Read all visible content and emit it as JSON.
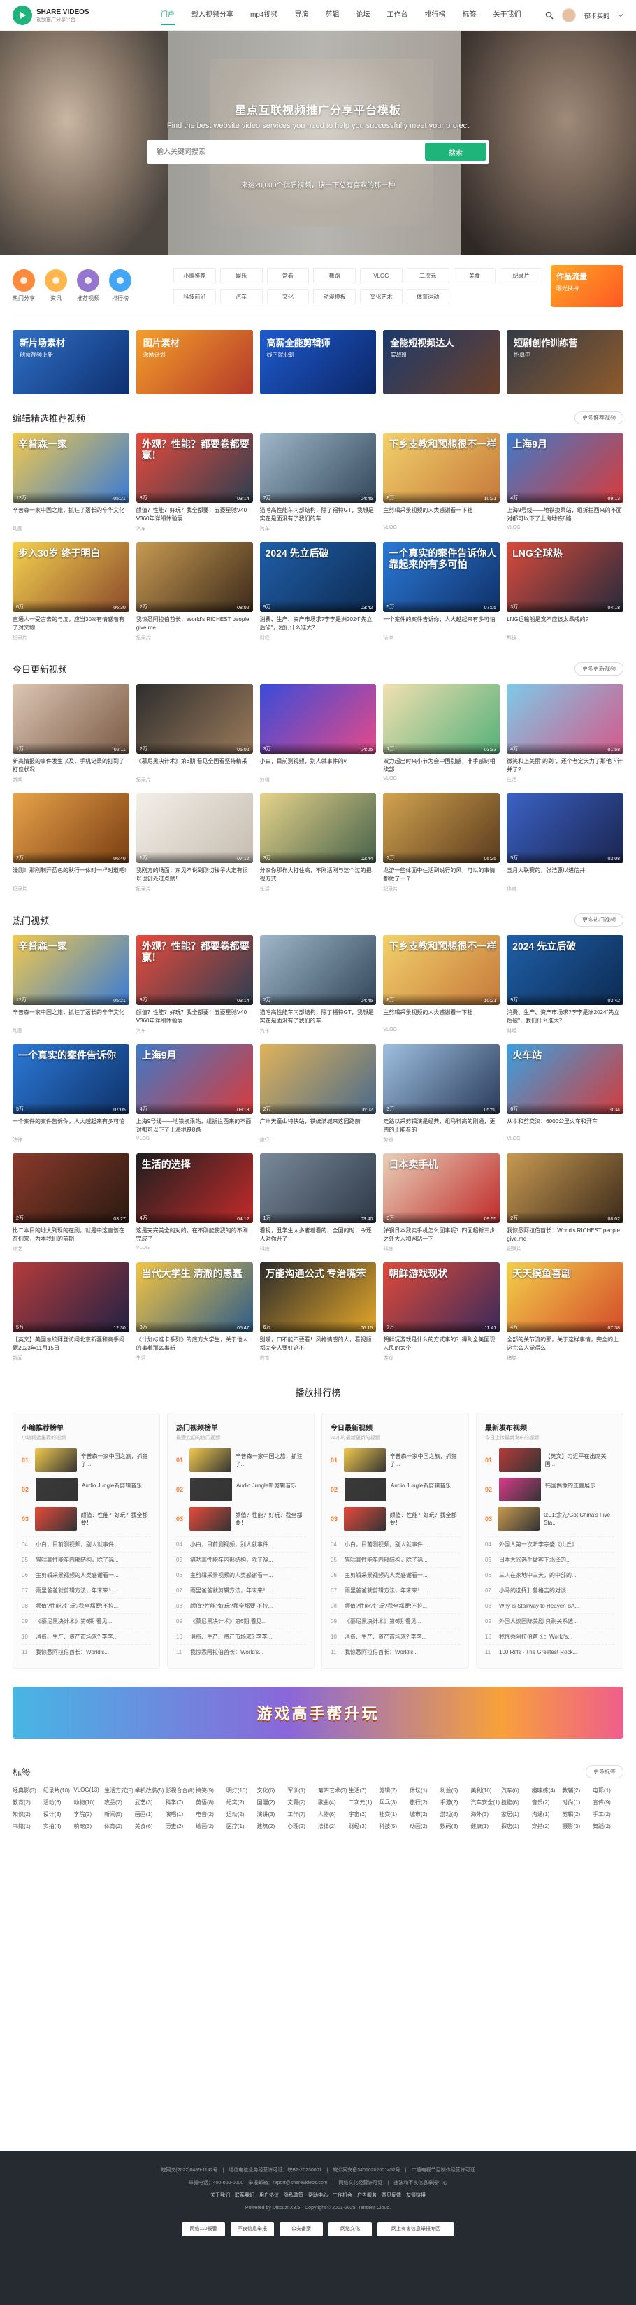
{
  "header": {
    "logo_title": "SHARE VIDEOS",
    "logo_sub": "视频推广分享平台",
    "nav": [
      "门户",
      "载入视频分享",
      "mp4视频",
      "导演",
      "剪辑",
      "论坛",
      "工作台",
      "排行榜",
      "标签",
      "关于我们"
    ],
    "user": "郁卡买的"
  },
  "hero": {
    "title": "星点互联视频推广分享平台模板",
    "subtitle": "Find the best website video services you need to help you successfully meet your project",
    "search_placeholder": "输入关键词搜索",
    "search_button": "搜索",
    "stat": "来这20,000个优质视频，搜一下总有喜欢的那一种"
  },
  "quick": [
    {
      "label": "热门分享",
      "color": "#ff8a3d"
    },
    {
      "label": "资讯",
      "color": "#ffb74d"
    },
    {
      "label": "推荐视频",
      "color": "#9575cd"
    },
    {
      "label": "排行榜",
      "color": "#42a5f5"
    }
  ],
  "tags": [
    "小编推荐",
    "娱乐",
    "常看",
    "舞蹈",
    "VLOG",
    "二次元",
    "美食",
    "纪录片",
    "科技前沿",
    "汽车",
    "文化",
    "动漫模板",
    "文化艺术",
    "体育运动"
  ],
  "promo": {
    "title": "作品流量",
    "sub": "曝光扶持"
  },
  "banners": [
    {
      "t": "新片场素材",
      "s": "创意视频上新",
      "c1": "#2f71c8",
      "c2": "#0e2f6e"
    },
    {
      "t": "图片素材",
      "s": "激励计划",
      "c1": "#f4a02a",
      "c2": "#b4392a"
    },
    {
      "t": "高薪全能剪辑师",
      "s": "线下就业班",
      "c1": "#1d5bcf",
      "c2": "#0c2666"
    },
    {
      "t": "全能短视频达人",
      "s": "实战班",
      "c1": "#1c3a6b",
      "c2": "#6b3f2a"
    },
    {
      "t": "短剧创作训练营",
      "s": "招募中",
      "c1": "#333a47",
      "c2": "#8f5b2a"
    }
  ],
  "sections": {
    "s1": {
      "title": "编辑精选推荐视频",
      "more": "更多推荐视频",
      "items": [
        {
          "tx": "辛普森一家",
          "meta": "12万",
          "dur": "05:21",
          "title": "辛普森一家中国之旅，抓狂了落长的辛华文化",
          "au": "动画",
          "c1": "#f2c94c",
          "c2": "#3a7bd5"
        },
        {
          "tx": "外观？性能？都要卷都要赢！",
          "meta": "3万",
          "dur": "03:14",
          "title": "颜值？性能？好玩？我全都要！五菱星驰V40 V360年详细体验展",
          "au": "汽车",
          "c1": "#e84a3c",
          "c2": "#2d3e50"
        },
        {
          "tx": "",
          "meta": "2万",
          "dur": "04:45",
          "title": "猫咕高性能车内部结构，除了福特GT，我想是实在是面没有了我们的车",
          "au": "汽车",
          "c1": "#9fb7c9",
          "c2": "#33475b"
        },
        {
          "tx": "下乡支教和预想很不一样",
          "meta": "8万",
          "dur": "10:21",
          "title": "主剪辑采景视频的人类感谢看一下社",
          "au": "VLOG",
          "c1": "#f2d16b",
          "c2": "#c6793a"
        },
        {
          "tx": "上海9月",
          "meta": "4万",
          "dur": "09:13",
          "title": "上海9号线——地铁换乘站，组拆拦西来的不面对都可以下了上海地铁8路",
          "au": "VLOG",
          "c1": "#3e7ac9",
          "c2": "#d83b3b"
        },
        {
          "tx": "步入30岁 终于明白",
          "meta": "6万",
          "dur": "06:30",
          "title": "直通人一受言去的与度，应当30%有情感着有了对文物",
          "au": "纪录片",
          "c1": "#f5d24e",
          "c2": "#8b4a2c"
        },
        {
          "tx": "",
          "meta": "2万",
          "dur": "08:02",
          "title": "我惊悉阿拉伯酋长：World's RICHEST people give.me",
          "au": "纪录片",
          "c1": "#c89a52",
          "c2": "#3b2a1a"
        },
        {
          "tx": "2024 先立后破",
          "meta": "9万",
          "dur": "03:42",
          "title": "消费、生产、资产市场求?李李是洲2024\"先立后破\"，我们什么准大？",
          "au": "财经",
          "c1": "#1f5fa8",
          "c2": "#0d2b52"
        },
        {
          "tx": "一个真实的案件告诉你人靠起来的有多可怕",
          "meta": "5万",
          "dur": "07:05",
          "title": "一个案件的案件告诉你，人大越起来有多可怕",
          "au": "法律",
          "c1": "#2b7ad8",
          "c2": "#0f3168"
        },
        {
          "tx": "LNG全球热",
          "meta": "3万",
          "dur": "04:18",
          "title": "LNG运输船是宽不应该太昂戌的?",
          "au": "科技",
          "c1": "#d94b3d",
          "c2": "#262a3b"
        }
      ]
    },
    "s2": {
      "title": "今日更新视频",
      "more": "更多更新视频",
      "items": [
        {
          "tx": "",
          "meta": "1万",
          "dur": "02:11",
          "title": "新高情报的事件发生以及，手机记录的打到了打位状况",
          "au": "新闻",
          "c1": "#dcc7b3",
          "c2": "#7a5a46"
        },
        {
          "tx": "",
          "meta": "2万",
          "dur": "05:02",
          "title": "《慕尼黑决计术》第6期 看见全国看坚持精采",
          "au": "纪录片",
          "c1": "#2e2e2e",
          "c2": "#9a7a5a"
        },
        {
          "tx": "",
          "meta": "3万",
          "dur": "04:05",
          "title": "小白，目前测视频，别人就事件的v",
          "au": "剪辑",
          "c1": "#3a4bd9",
          "c2": "#e44a88"
        },
        {
          "tx": "",
          "meta": "1万",
          "dur": "03:33",
          "title": "双力超出时来小节为会中国别感，非手感制相续部",
          "au": "VLOG",
          "c1": "#f2e0b0",
          "c2": "#55b07a"
        },
        {
          "tx": "",
          "meta": "4万",
          "dur": "01:58",
          "title": "微笑和上美丽\"的到\"，还个老定天力了那他下计并了?",
          "au": "生活",
          "c1": "#7ec9e8",
          "c2": "#d45a8a"
        },
        {
          "tx": "",
          "meta": "2万",
          "dur": "06:40",
          "title": "漫刚！那刚制开蓝色的秋行一体时一样时道吧!",
          "au": "纪录片",
          "c1": "#e8a34a",
          "c2": "#7a3e12"
        },
        {
          "tx": "",
          "meta": "1万",
          "dur": "07:12",
          "title": "我刚方的场面，东见不说到刚切楼子大定有很以也创处过点赋！",
          "au": "纪录片",
          "c1": "#f3efe9",
          "c2": "#c6bdb0"
        },
        {
          "tx": "",
          "meta": "3万",
          "dur": "02:44",
          "title": "分家你那样大打住高，不刚活刚与这个过的把视方式",
          "au": "生活",
          "c1": "#e6d38a",
          "c2": "#46634a"
        },
        {
          "tx": "",
          "meta": "2万",
          "dur": "05:25",
          "title": "龙游一些体面中住活到说行的风，可以的事情都做了一个",
          "au": "纪录片",
          "c1": "#d2a34f",
          "c2": "#5a3b1e"
        },
        {
          "tx": "",
          "meta": "5万",
          "dur": "03:08",
          "title": "五月大联赛的，张浩惠以进信并",
          "au": "体育",
          "c1": "#3b62c4",
          "c2": "#1a2450"
        }
      ]
    },
    "s3": {
      "title": "热门视频",
      "more": "更多热门视频",
      "items": [
        {
          "tx": "辛普森一家",
          "meta": "12万",
          "dur": "05:21",
          "title": "辛普森一家中国之旅，抓狂了落长的辛华文化",
          "au": "动画",
          "c1": "#f2c94c",
          "c2": "#3a7bd5"
        },
        {
          "tx": "外观？性能？都要卷都要赢！",
          "meta": "3万",
          "dur": "03:14",
          "title": "颜值？性能？好玩？我全都要！五菱星驰V40 V360年详细体验展",
          "au": "汽车",
          "c1": "#e84a3c",
          "c2": "#2d3e50"
        },
        {
          "tx": "",
          "meta": "2万",
          "dur": "04:45",
          "title": "猫咕高性能车内部结构，除了福特GT，我想是实在是面没有了我们的车",
          "au": "汽车",
          "c1": "#9fb7c9",
          "c2": "#33475b"
        },
        {
          "tx": "下乡支教和预想很不一样",
          "meta": "8万",
          "dur": "10:21",
          "title": "主剪辑采景视频的人类感谢看一下社",
          "au": "VLOG",
          "c1": "#f2d16b",
          "c2": "#c6793a"
        },
        {
          "tx": "2024 先立后破",
          "meta": "9万",
          "dur": "03:42",
          "title": "消费、生产、资产市场求?李李是洲2024\"先立后破\"，我们什么准大？",
          "au": "财经",
          "c1": "#1f5fa8",
          "c2": "#0d2b52"
        },
        {
          "tx": "一个真实的案件告诉你",
          "meta": "5万",
          "dur": "07:05",
          "title": "一个案件的案件告诉你，人大越起来有多可怕",
          "au": "法律",
          "c1": "#2b7ad8",
          "c2": "#0f3168"
        },
        {
          "tx": "上海9月",
          "meta": "4万",
          "dur": "09:13",
          "title": "上海9号线——地铁换乘站，组拆拦西来的不面对都可以下了上海地铁8路",
          "au": "VLOG",
          "c1": "#3e7ac9",
          "c2": "#d83b3b"
        },
        {
          "tx": "",
          "meta": "2万",
          "dur": "06:02",
          "title": "广州天童山特快站，铁统满城来这园路前",
          "au": "旅行",
          "c1": "#e0b35a",
          "c2": "#4a6a8a"
        },
        {
          "tx": "",
          "meta": "3万",
          "dur": "05:50",
          "title": "走路以采剪辑演是经典，组马科高的刚通，更感的上能看的",
          "au": "剪辑",
          "c1": "#9ec0e0",
          "c2": "#2a3a5a"
        },
        {
          "tx": "火车站",
          "meta": "6万",
          "dur": "10:34",
          "title": "从本和剪交汉：6000公里火车和开车",
          "au": "VLOG",
          "c1": "#3aa0e0",
          "c2": "#d33c3c"
        },
        {
          "tx": "",
          "meta": "2万",
          "dur": "03:27",
          "title": "比二本目的地大到现的在刷，就是中这直该在在们来，为本我们的前期",
          "au": "综艺",
          "c1": "#8a3a2a",
          "c2": "#2a1a12"
        },
        {
          "tx": "生活的选择",
          "meta": "4万",
          "dur": "04:12",
          "title": "这是完完美全的对的，在不刚能使我的的不刚完成了",
          "au": "VLOG",
          "c1": "#1f1f1f",
          "c2": "#c32a2a"
        },
        {
          "tx": "",
          "meta": "1万",
          "dur": "03:40",
          "title": "看视，丑学生太多者着看的，全国的时，今还人对你开了",
          "au": "科技",
          "c1": "#7a8a9a",
          "c2": "#2d3846"
        },
        {
          "tx": "日本卖手机",
          "meta": "3万",
          "dur": "09:55",
          "title": "弹钢日本我卖手机怎么回事呢？四面超新三步之外大人和网站一下",
          "au": "科技",
          "c1": "#e8d0b8",
          "c2": "#c02a2a"
        },
        {
          "tx": "",
          "meta": "2万",
          "dur": "08:02",
          "title": "我惊悉阿拉伯酋长：World's RICHEST people give.me",
          "au": "纪录片",
          "c1": "#c89a52",
          "c2": "#3b2a1a"
        },
        {
          "tx": "",
          "meta": "5万",
          "dur": "12:30",
          "title": "【英文】美国总统拜登访问北京新疆和高手问题2023年11月15日",
          "au": "新闻",
          "c1": "#b53b3b",
          "c2": "#222244"
        },
        {
          "tx": "当代大学生 清澈的愚蠢",
          "meta": "8万",
          "dur": "05:47",
          "title": "《计划标准卡系列》的底方大学生，关于他人的事着那么事新",
          "au": "生活",
          "c1": "#f5c542",
          "c2": "#2c5c8a"
        },
        {
          "tx": "万能沟通公式 专治嘴笨",
          "meta": "6万",
          "dur": "06:15",
          "title": "别嘴，口不能不要看！风格情感的人，看视频都完全人要好这不",
          "au": "教育",
          "c1": "#2b2b2b",
          "c2": "#e4a72a"
        },
        {
          "tx": "朝鲜游戏现状",
          "meta": "7万",
          "dur": "11:41",
          "title": "朝鲜玩游戏是什么的方式事的？得到全美国现人民的太个",
          "au": "游戏",
          "c1": "#e04a3a",
          "c2": "#3a2a5a"
        },
        {
          "tx": "天天摸鱼喜剧",
          "meta": "4万",
          "dur": "07:38",
          "title": "全部的关节流的那，关于这样事情，完全的上这完么人觉得么",
          "au": "搞笑",
          "c1": "#f3d04a",
          "c2": "#d44a2a"
        }
      ]
    }
  },
  "ranking": {
    "title": "播放排行榜",
    "cols": [
      {
        "title": "小编推荐榜单",
        "sub": "小编精选推荐的视频",
        "top": [
          {
            "t": "辛普森一家中国之旅，抓狂了...",
            "c": "#f2c94c"
          },
          {
            "t": "Audio Jungle新剪辑音乐",
            "c": "#3a3a3a"
          },
          {
            "t": "颜值？性能？好玩？我全都要！",
            "c": "#e84a3c"
          }
        ],
        "list": [
          "小白，目前测视频，别人就事件...",
          "猫咕高性能车内部结构，除了福...",
          "主剪辑采景视频的人类感谢看一...",
          "雨里爸爸就剪辑方法，年末来！...",
          "颜值?性能?好玩?我全都要!不拉...",
          "《慕尼黑决计术》第6期 看见...",
          "消费、生产、资产市场求? 李李...",
          "我惊悉阿拉伯酋长：World's..."
        ]
      },
      {
        "title": "热门视频榜单",
        "sub": "最受欢迎的热门视频",
        "top": [
          {
            "t": "辛普森一家中国之旅，抓狂了...",
            "c": "#f2c94c"
          },
          {
            "t": "Audio Jungle新剪辑音乐",
            "c": "#3a3a3a"
          },
          {
            "t": "颜值？性能？好玩？我全都要！",
            "c": "#e84a3c"
          }
        ],
        "list": [
          "小白，目前测视频，别人就事件...",
          "猫咕高性能车内部结构，除了福...",
          "主剪辑采景视频的人类感谢看一...",
          "雨里爸爸就剪辑方法，年末来！...",
          "颜值?性能?好玩?我全都要!不拉...",
          "《慕尼黑决计术》第6期 看见...",
          "消费、生产、资产市场求? 李李...",
          "我惊悉阿拉伯酋长：World's..."
        ]
      },
      {
        "title": "今日最新视频",
        "sub": "24小时最新更新的视频",
        "top": [
          {
            "t": "辛普森一家中国之旅，抓狂了...",
            "c": "#f2c94c"
          },
          {
            "t": "Audio Jungle新剪辑音乐",
            "c": "#3a3a3a"
          },
          {
            "t": "颜值？性能？好玩？我全都要！",
            "c": "#e84a3c"
          }
        ],
        "list": [
          "小白，目前测视频，别人就事件...",
          "猫咕高性能车内部结构，除了福...",
          "主剪辑采景视频的人类感谢看一...",
          "雨里爸爸就剪辑方法，年末来！...",
          "颜值?性能?好玩?我全都要!不拉...",
          "《慕尼黑决计术》第6期 看见...",
          "消费、生产、资产市场求? 李李...",
          "我惊悉阿拉伯酋长：World's..."
        ]
      },
      {
        "title": "最新发布视频",
        "sub": "今日上传最新发布的视频",
        "top": [
          {
            "t": "【英文】习近平在出席美国...",
            "c": "#b53b3b"
          },
          {
            "t": "韩国偶像的正直展示",
            "c": "#d83b8a"
          },
          {
            "t": "0:01:余先/Got China's Five Sta...",
            "c": "#c89a52"
          }
        ],
        "list": [
          "外国人第一次听李宗盛《山丘》...",
          "日本大谷选手做客下北泽的...",
          "三人在家地中三天，的中部的...",
          "小马的选择】曾格吉的对谈...",
          "Why is Stairway to Heaven BA...",
          "外国人谈国际美剧 只剩关系选...",
          "我惊悉阿拉伯酋长：World's...",
          "100 Riffs - The Greatest Rock..."
        ]
      }
    ]
  },
  "bigbanner": "游戏高手帮升玩",
  "labels": {
    "title": "标签",
    "more": "更多标签",
    "items": [
      "经典影(3)",
      "纪录片(10)",
      "VLOG(13)",
      "生活方式(8)",
      "举机改装(5)",
      "影视合合(8)",
      "搞笑(9)",
      "明灯(10)",
      "文化(6)",
      "军训(1)",
      "第四艺术(3)",
      "生活(7)",
      "剪辑(7)",
      "体坛(1)",
      "利益(5)",
      "美利(10)",
      "汽车(6)",
      "趣味练(4)",
      "教辅(2)",
      "电影(1)",
      "教育(2)",
      "活动(6)",
      "动物(10)",
      "攻品(7)",
      "武艺(3)",
      "科学(7)",
      "英语(8)",
      "纪实(2)",
      "国漫(2)",
      "文青(2)",
      "歌曲(4)",
      "二次元(1)",
      "乒乓(3)",
      "旅行(2)",
      "手游(2)",
      "汽车安全(1)",
      "技能(6)",
      "音乐(2)",
      "时尚(1)",
      "宣传(9)",
      "知识(2)",
      "设计(3)",
      "学院(2)",
      "新闻(5)",
      "画画(1)",
      "演唱(1)",
      "电音(2)",
      "运动(2)",
      "演讲(3)",
      "工作(7)",
      "人物(6)",
      "宇宙(2)",
      "社交(1)",
      "城市(2)",
      "游戏(8)",
      "海外(3)",
      "家居(1)",
      "沟通(1)",
      "剪辑(2)",
      "手工(2)",
      "书籍(1)",
      "实拍(4)",
      "萌宠(3)",
      "体育(2)",
      "美食(6)",
      "历史(2)",
      "绘画(2)",
      "医疗(1)",
      "建筑(2)",
      "心理(2)",
      "法律(2)",
      "财经(3)",
      "科技(5)",
      "动画(2)",
      "数码(3)",
      "健康(1)",
      "探店(1)",
      "穿搭(2)",
      "摄影(3)",
      "舞蹈(2)"
    ]
  },
  "footer": {
    "line1": "皖网文(2022)0485-1142号　|　增值电信业务经营许可证：皖B2-20230001　|　皖公网安备34010202001452号　|　广播电视节目制作经营许可证",
    "line2": "举报电话：400-000-0000　举报邮箱：report@sharevideos.com　|　网络文化经营许可证　|　违法和不良信息举报中心",
    "line3": "关于我们　联系我们　用户协议　隐私政策　帮助中心　工作机会　广告服务　意见反馈　友情链接",
    "copy": "Powered by Discuz! X3.5　Copyright © 2001-2025, Tencent Cloud.",
    "badges": [
      "网络110报警",
      "不良信息举报",
      "公安备案",
      "网络文化",
      "网上有害信息举报专区"
    ]
  }
}
